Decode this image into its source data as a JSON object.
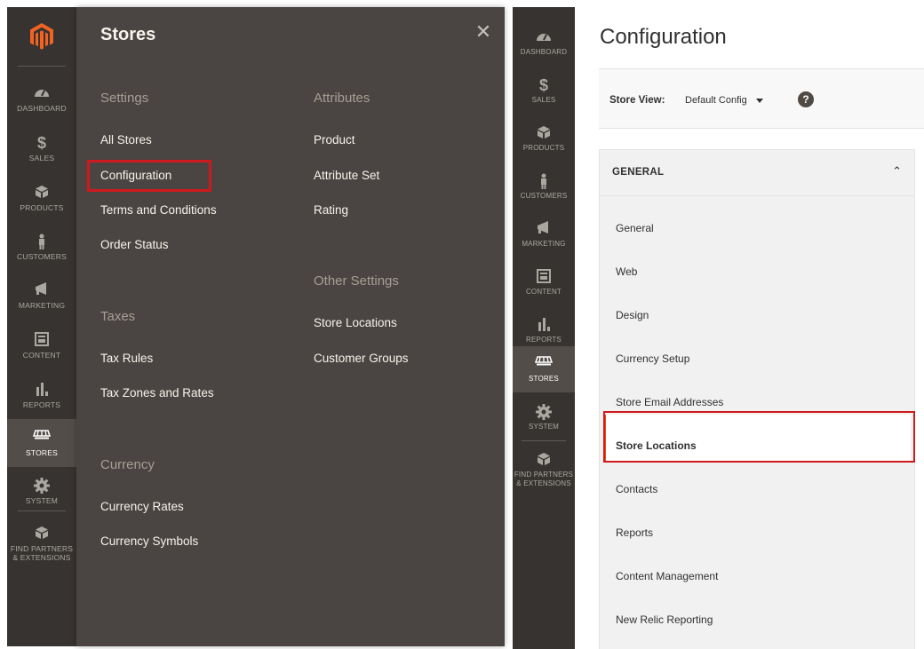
{
  "left": {
    "sidebar": [
      {
        "key": "dashboard",
        "label": "DASHBOARD"
      },
      {
        "key": "sales",
        "label": "SALES"
      },
      {
        "key": "products",
        "label": "PRODUCTS"
      },
      {
        "key": "customers",
        "label": "CUSTOMERS"
      },
      {
        "key": "marketing",
        "label": "MARKETING"
      },
      {
        "key": "content",
        "label": "CONTENT"
      },
      {
        "key": "reports",
        "label": "REPORTS"
      },
      {
        "key": "stores",
        "label": "STORES",
        "active": true
      },
      {
        "key": "system",
        "label": "SYSTEM"
      },
      {
        "key": "partners",
        "label": "FIND PARTNERS & EXTENSIONS"
      }
    ],
    "flyout": {
      "title": "Stores",
      "settings": {
        "title": "Settings",
        "items": [
          "All Stores",
          "Configuration",
          "Terms and Conditions",
          "Order Status"
        ]
      },
      "taxes": {
        "title": "Taxes",
        "items": [
          "Tax Rules",
          "Tax Zones and Rates"
        ]
      },
      "currency": {
        "title": "Currency",
        "items": [
          "Currency Rates",
          "Currency Symbols"
        ]
      },
      "attributes": {
        "title": "Attributes",
        "items": [
          "Product",
          "Attribute Set",
          "Rating"
        ]
      },
      "other": {
        "title": "Other Settings",
        "items": [
          "Store Locations",
          "Customer Groups"
        ]
      }
    }
  },
  "right": {
    "title": "Configuration",
    "scope": {
      "label": "Store View:",
      "value": "Default Config"
    },
    "group": {
      "title": "GENERAL",
      "items": [
        "General",
        "Web",
        "Design",
        "Currency Setup",
        "Store Email Addresses",
        "Store Locations",
        "Contacts",
        "Reports",
        "Content Management",
        "New Relic Reporting"
      ],
      "active_item": "Store Locations"
    }
  },
  "colors": {
    "sidebar": "#373330",
    "flyout": "#4a4542",
    "highlight": "#d0191c",
    "brand_orange": "#eb5202"
  }
}
